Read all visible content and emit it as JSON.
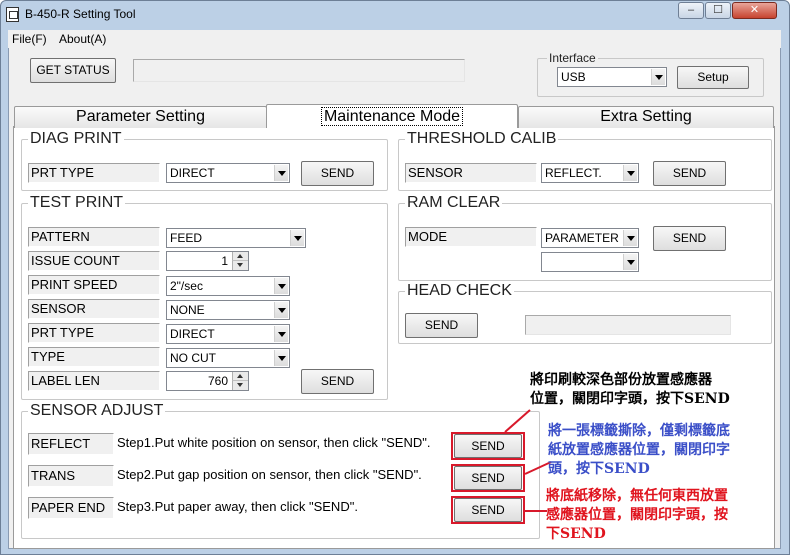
{
  "window": {
    "title": "B-450-R Setting Tool",
    "controls": [
      "–",
      "☐",
      "✕"
    ]
  },
  "menu": [
    {
      "label": "File(F)"
    },
    {
      "label": "About(A)"
    }
  ],
  "status_bar": {
    "get_status_label": "GET STATUS",
    "status_text": ""
  },
  "interface": {
    "legend": "Interface",
    "selected": "USB",
    "setup_label": "Setup"
  },
  "tabs": [
    {
      "label": "Parameter Setting"
    },
    {
      "label": "Maintenance Mode",
      "active": true
    },
    {
      "label": "Extra Setting"
    }
  ],
  "diag_print": {
    "legend": "DIAG PRINT",
    "label": "PRT TYPE",
    "value": "DIRECT",
    "send": "SEND"
  },
  "threshold_calib": {
    "legend": "THRESHOLD CALIB",
    "label": "SENSOR",
    "value": "REFLECT.",
    "send": "SEND"
  },
  "test_print": {
    "legend": "TEST PRINT",
    "rows": [
      {
        "label": "PATTERN",
        "value": "FEED"
      },
      {
        "label": "ISSUE COUNT",
        "value": "1"
      },
      {
        "label": "PRINT SPEED",
        "value": "2\"/sec"
      },
      {
        "label": "SENSOR",
        "value": "NONE"
      },
      {
        "label": "PRT TYPE",
        "value": "DIRECT"
      },
      {
        "label": "TYPE",
        "value": "NO CUT"
      },
      {
        "label": "LABEL LEN",
        "value": "760"
      }
    ],
    "send": "SEND"
  },
  "ram_clear": {
    "legend": "RAM CLEAR",
    "label": "MODE",
    "value": "PARAMETER",
    "value2": "",
    "send": "SEND"
  },
  "head_check": {
    "legend": "HEAD CHECK",
    "send": "SEND",
    "result": ""
  },
  "sensor_adjust": {
    "legend": "SENSOR ADJUST",
    "rows": [
      {
        "label": "REFLECT",
        "step": "Step1.Put white position on sensor, then click \"SEND\".",
        "send": "SEND"
      },
      {
        "label": "TRANS",
        "step": "Step2.Put gap position on sensor, then click \"SEND\".",
        "send": "SEND"
      },
      {
        "label": "PAPER END",
        "step": "Step3.Put paper away, then click \"SEND\".",
        "send": "SEND"
      }
    ]
  },
  "annotations": {
    "note1_line1": "將印刷較深色部份放置感應器",
    "note1_line2": "位置，關閉印字頭，按下SEND",
    "note2_line1": "將一張標籤撕除，僅剩標籤底",
    "note2_line2": "紙放置感應器位置，關閉印字",
    "note2_line3": "頭，按下SEND",
    "note3_line1": "將底紙移除，無任何東西放置",
    "note3_line2": "感應器位置，關閉印字頭，按",
    "note3_line3": "下SEND",
    "colors": {
      "note1": "#000000",
      "note2": "#3b4fc8",
      "note3": "#e0141e",
      "highlight": "#d8192b"
    }
  }
}
